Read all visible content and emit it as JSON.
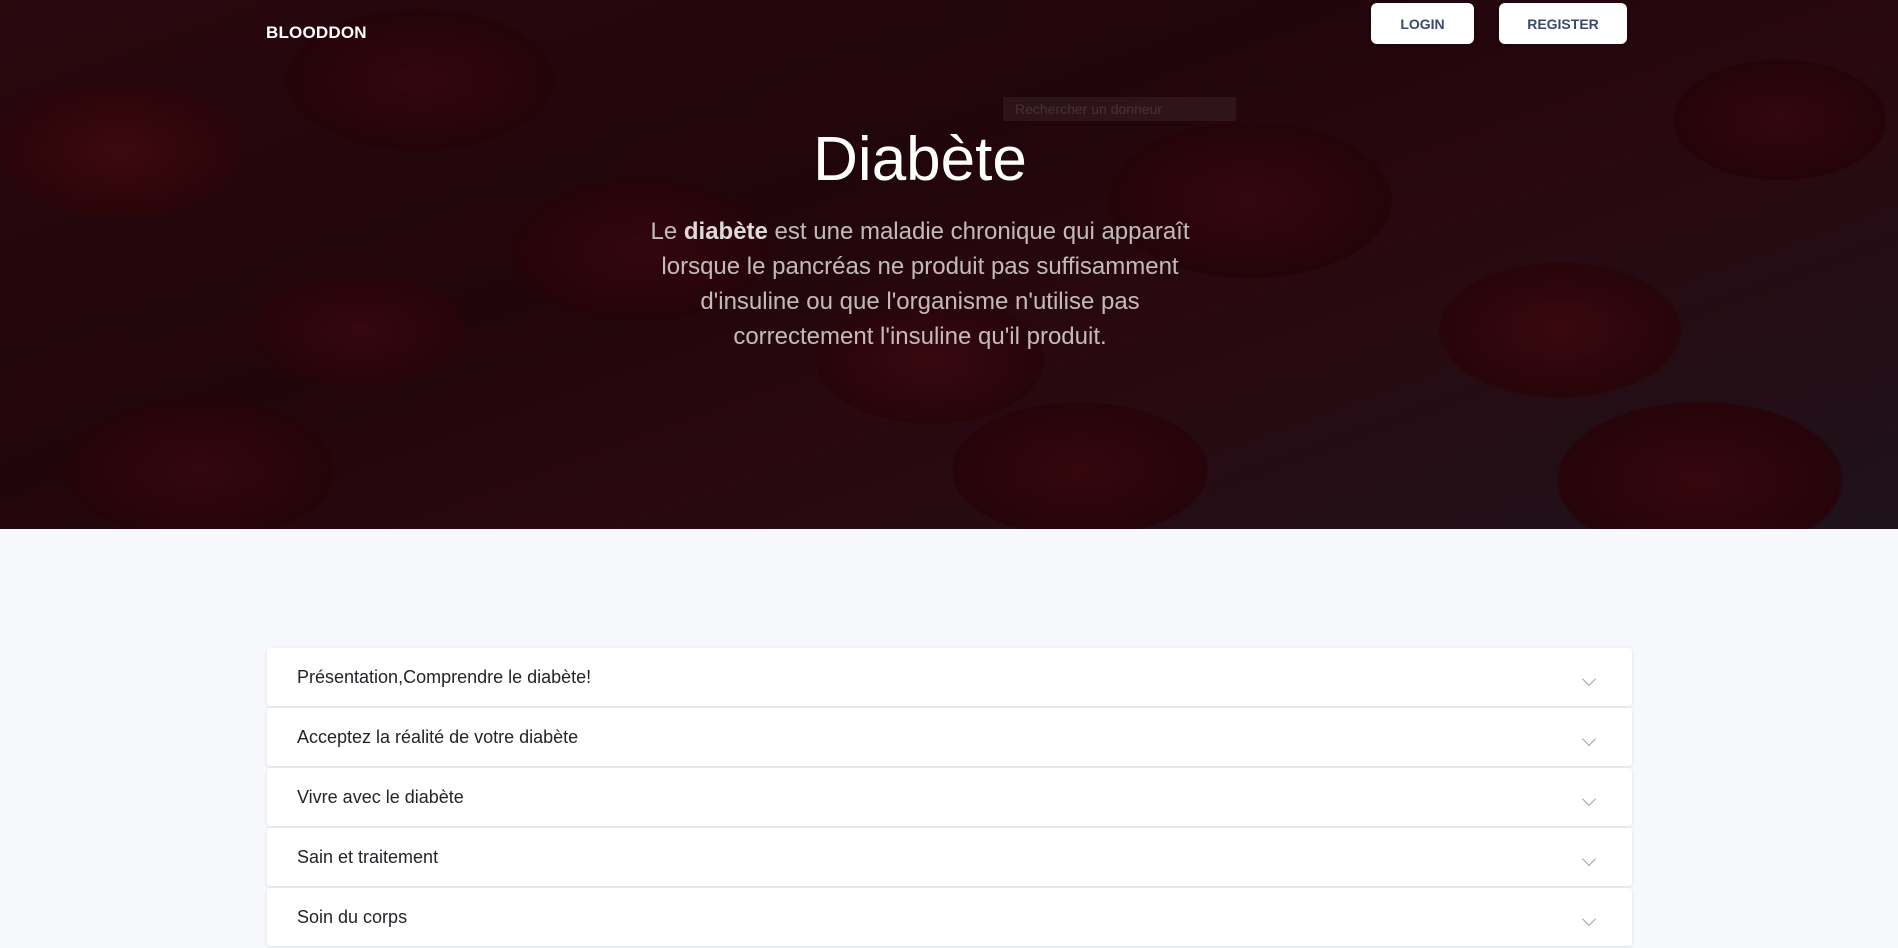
{
  "header": {
    "brand": "BLOODDON",
    "login_label": "LOGIN",
    "register_label": "REGISTER",
    "ghost_input_text": "Rechercher un donneur"
  },
  "hero": {
    "title": "Diabète",
    "description_prefix": "Le ",
    "description_strong": "diabète",
    "description_rest": " est une maladie chronique qui apparaît lorsque le pancréas ne produit pas suffisamment d'insuline ou que l'organisme n'utilise pas correctement l'insuline qu'il produit."
  },
  "accordion": {
    "items": [
      {
        "label": "Présentation,Comprendre le diabète!",
        "icon": "chevron-down-icon"
      },
      {
        "label": "Acceptez la réalité de votre diabète",
        "icon": "chevron-down-icon"
      },
      {
        "label": "Vivre avec le diabète",
        "icon": "chevron-down-icon"
      },
      {
        "label": "Sain et traitement",
        "icon": "chevron-down-icon"
      },
      {
        "label": "Soin du corps",
        "icon": "chevron-down-icon"
      }
    ]
  },
  "colors": {
    "page_background": "#f6f8fc",
    "hero_tint": "#2a0509",
    "button_text": "#3b4a6b"
  }
}
